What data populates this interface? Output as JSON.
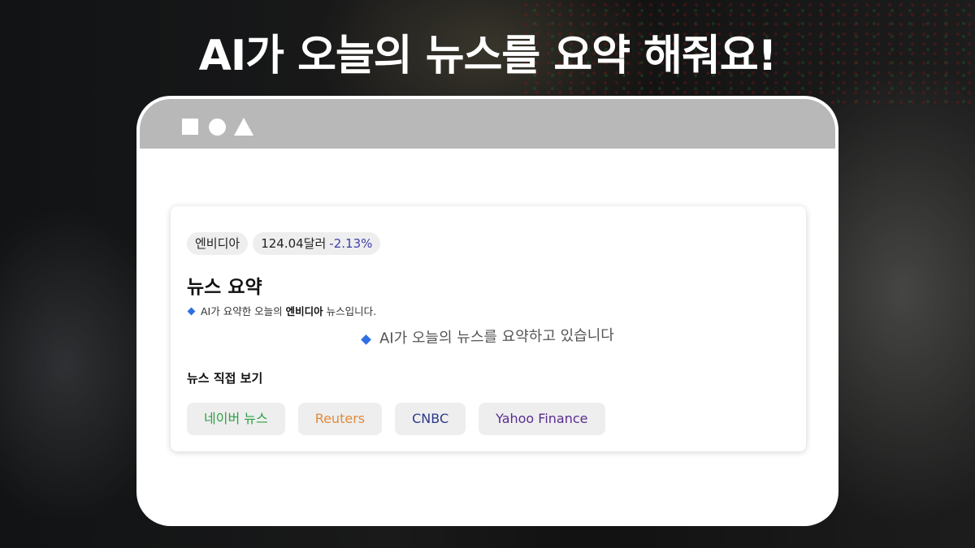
{
  "headline": "AI가 오늘의 뉴스를 요약 해줘요!",
  "window": {
    "controls": [
      "square-icon",
      "circle-icon",
      "triangle-icon"
    ]
  },
  "card": {
    "company_chip": "엔비디아",
    "price": "124.04달러",
    "change": "-2.13%",
    "summary_title": "뉴스 요약",
    "summary_line": {
      "prefix": "AI가 요약한 오늘의",
      "company": "엔비디아",
      "suffix": "뉴스입니다."
    },
    "loading_text": "AI가 오늘의 뉴스를 요약하고 있습니다",
    "links_title": "뉴스 직접 보기",
    "links": [
      {
        "label": "네이버 뉴스",
        "color": "#2ea043"
      },
      {
        "label": "Reuters",
        "color": "#e08a3c"
      },
      {
        "label": "CNBC",
        "color": "#2b3a8a"
      },
      {
        "label": "Yahoo Finance",
        "color": "#5a2d91"
      }
    ]
  },
  "colors": {
    "change_text": "#3b3fa8",
    "bullet": "#2f6fe3",
    "titlebar": "#b8b8b8"
  }
}
